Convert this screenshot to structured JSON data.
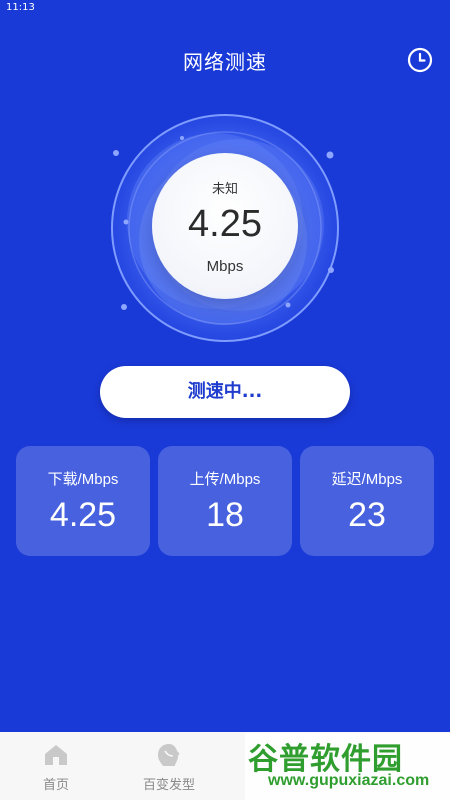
{
  "status_bar": {
    "time": "11:13"
  },
  "header": {
    "title": "网络测速",
    "history_icon": "clock-icon"
  },
  "gauge": {
    "status": "未知",
    "value": "4.25",
    "unit": "Mbps"
  },
  "action": {
    "label": "测速中..."
  },
  "stats": [
    {
      "label": "下载/Mbps",
      "value": "4.25"
    },
    {
      "label": "上传/Mbps",
      "value": "18"
    },
    {
      "label": "延迟/Mbps",
      "value": "23"
    }
  ],
  "bottom_nav": {
    "items": [
      {
        "label": "首页",
        "icon": "home-icon"
      },
      {
        "label": "百变发型",
        "icon": "hairstyle-icon"
      }
    ]
  },
  "watermark": {
    "text": "谷普软件园",
    "url": "www.gupuxiazai.com"
  },
  "colors": {
    "background": "#1a3ad8",
    "button_text": "#1f3ccf",
    "watermark": "#2f9e2f"
  }
}
